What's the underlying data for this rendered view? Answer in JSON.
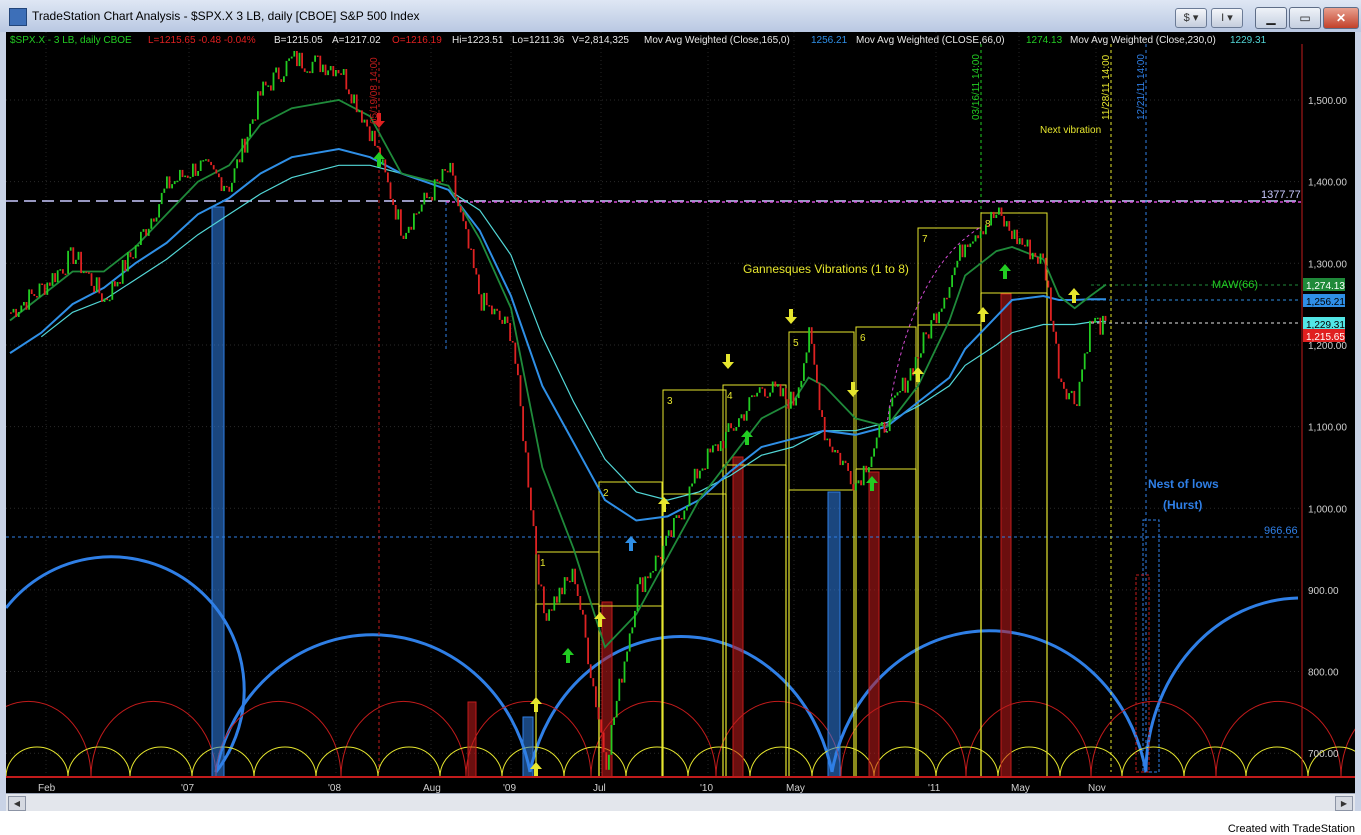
{
  "window": {
    "title": "TradeStation Chart Analysis - $SPX.X 3 LB, daily [CBOE] S&P 500 Index",
    "symbol_button": "$",
    "tools_button": "I"
  },
  "status": {
    "symbol": "$SPX.X - 3 LB, daily  CBOE",
    "last": "L=1215.65  -0.48  -0.04%",
    "bid": "B=1215.05",
    "ask": "A=1217.02",
    "open": "O=1216.19",
    "high": "Hi=1223.51",
    "low": "Lo=1211.36",
    "volume": "V=2,814,325",
    "ma1_label": "Mov Avg Weighted (Close,165,0)",
    "ma1_value": "1256.21",
    "ma2_label": "Mov Avg Weighted (CLOSE,66,0)",
    "ma2_value": "1274.13",
    "ma3_label": "Mov Avg Weighted (Close,230,0)",
    "ma3_value": "1229.31"
  },
  "annotations": {
    "vibrations": "Gannesques Vibrations (1 to 8)",
    "next_vibration": "Next vibration",
    "nest1": "Nest of lows",
    "nest2": "(Hurst)",
    "maw": "MAW(66)",
    "level_high": "1377.77",
    "level_low": "966.66",
    "date1": "05/19/08 14:00",
    "date2": "03/16/11 14:00",
    "date3": "11/28/11 14:00",
    "date4": "12/21/11 14:00",
    "box_numbers": [
      "1",
      "2",
      "3",
      "4",
      "5",
      "6",
      "7",
      "8"
    ]
  },
  "footer": {
    "credit": "Created with TradeStation"
  },
  "colors": {
    "background": "#000000",
    "up_bar": "#22cc22",
    "down_bar": "#dd2222",
    "ma165": "#2f8fe6",
    "ma66": "#1f8a3a",
    "ma230": "#52d6d6",
    "box": "#e6e62e",
    "cycle_blue": "#2f7fe6",
    "cycle_red": "#c21b1b",
    "cycle_yellow": "#e6e62e"
  },
  "chart_data": {
    "type": "line",
    "title": "$SPX.X 3 LB, daily [CBOE] S&P 500 Index",
    "x_tick_labels": [
      "Feb",
      "'07",
      "'08",
      "Aug",
      "'09",
      "Jul",
      "'10",
      "May",
      "'11",
      "May",
      "Nov"
    ],
    "y_tick_labels": [
      "1,500.00",
      "1,400.00",
      "1,300.00",
      "1,200.00",
      "1,100.00",
      "1,000.00",
      "900.00",
      "800.00",
      "700.00"
    ],
    "ylim": [
      665,
      1560
    ],
    "x": [
      "2006-01",
      "2006-03",
      "2006-05",
      "2006-07",
      "2006-09",
      "2006-11",
      "2007-01",
      "2007-03",
      "2007-05",
      "2007-07",
      "2007-10",
      "2007-12",
      "2008-02",
      "2008-05",
      "2008-07",
      "2008-09",
      "2008-11",
      "2009-01",
      "2009-03",
      "2009-05",
      "2009-07",
      "2009-09",
      "2009-11",
      "2010-01",
      "2010-03",
      "2010-04",
      "2010-05",
      "2010-07",
      "2010-09",
      "2010-11",
      "2011-01",
      "2011-02",
      "2011-04",
      "2011-05",
      "2011-07",
      "2011-08",
      "2011-09",
      "2011-10",
      "2011-11"
    ],
    "series": [
      {
        "name": "$SPX.X",
        "values": [
          1240,
          1270,
          1310,
          1255,
          1320,
          1395,
          1420,
          1395,
          1510,
          1550,
          1540,
          1460,
          1340,
          1415,
          1255,
          1215,
          870,
          920,
          690,
          900,
          960,
          1050,
          1095,
          1150,
          1130,
          1210,
          1090,
          1030,
          1110,
          1190,
          1280,
          1330,
          1360,
          1335,
          1300,
          1160,
          1130,
          1230,
          1220
        ]
      },
      {
        "name": "Mov Avg Weighted (Close,165,0)",
        "values": [
          1190,
          1215,
          1250,
          1270,
          1300,
          1325,
          1360,
          1380,
          1410,
          1430,
          1440,
          1430,
          1410,
          1390,
          1340,
          1260,
          1150,
          1080,
          1010,
          985,
          990,
          1010,
          1045,
          1075,
          1085,
          1090,
          1095,
          1090,
          1100,
          1130,
          1160,
          1195,
          1235,
          1255,
          1260,
          1255,
          1255,
          1256,
          1256
        ]
      },
      {
        "name": "Mov Avg Weighted (CLOSE,66,0)",
        "values": [
          1230,
          1260,
          1290,
          1290,
          1320,
          1360,
          1400,
          1420,
          1470,
          1490,
          1500,
          1480,
          1410,
          1395,
          1330,
          1245,
          1050,
          950,
          830,
          870,
          940,
          1010,
          1060,
          1110,
          1130,
          1160,
          1150,
          1110,
          1100,
          1150,
          1230,
          1285,
          1315,
          1320,
          1305,
          1260,
          1245,
          1260,
          1274
        ]
      },
      {
        "name": "Mov Avg Weighted (Close,230,0)",
        "values": [
          null,
          1210,
          1240,
          1255,
          1280,
          1305,
          1335,
          1360,
          1385,
          1405,
          1420,
          1420,
          1410,
          1390,
          1365,
          1310,
          1210,
          1130,
          1060,
          1020,
          1010,
          1020,
          1040,
          1065,
          1075,
          1085,
          1095,
          1095,
          1105,
          1125,
          1150,
          1175,
          1200,
          1215,
          1225,
          1225,
          1225,
          1228,
          1229
        ]
      }
    ],
    "right_axis_labels": [
      "1,274.13",
      "1,256.21",
      "1,229.31",
      "1,215.65"
    ],
    "levels": [
      1377.77,
      966.66
    ],
    "legend": "top-left",
    "grid": true
  }
}
